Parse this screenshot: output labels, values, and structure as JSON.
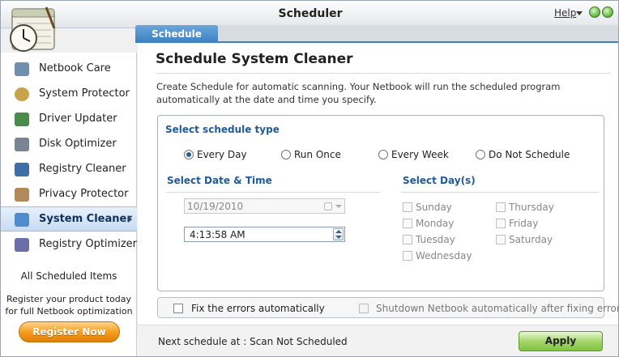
{
  "window": {
    "title": "Scheduler",
    "help_label": "Help"
  },
  "tabs": [
    {
      "label": "Schedule"
    }
  ],
  "sidebar": {
    "items": [
      {
        "label": "Netbook Care",
        "icon": "netbook-care-icon",
        "color": "#6f8fae"
      },
      {
        "label": "System Protector",
        "icon": "shield-icon",
        "color": "#c9a24a"
      },
      {
        "label": "Driver Updater",
        "icon": "driver-icon",
        "color": "#4a8b4a"
      },
      {
        "label": "Disk Optimizer",
        "icon": "disk-icon",
        "color": "#7a8594"
      },
      {
        "label": "Registry Cleaner",
        "icon": "registry-cleaner-icon",
        "color": "#3d6fa6"
      },
      {
        "label": "Privacy Protector",
        "icon": "privacy-icon",
        "color": "#b08a5a"
      },
      {
        "label": "System Cleaner",
        "icon": "broom-icon",
        "color": "#4f8ccc"
      },
      {
        "label": "Registry Optimizer",
        "icon": "registry-optimizer-icon",
        "color": "#6a6fa8"
      }
    ],
    "active_index": 6,
    "all_scheduled_label": "All Scheduled Items",
    "register_text_line1": "Register your product today",
    "register_text_line2": "for full Netbook optimization",
    "register_button": "Register Now"
  },
  "main": {
    "title": "Schedule System Cleaner",
    "description": "Create Schedule for automatic scanning. Your Netbook will run the scheduled program automatically at the date and time you specify.",
    "schedule_type_heading": "Select schedule type",
    "schedule_types": [
      "Every Day",
      "Run Once",
      "Every Week",
      "Do Not Schedule"
    ],
    "selected_schedule_type": "Every Day",
    "date_time_heading": "Select Date & Time",
    "date_value": "10/19/2010",
    "time_value": "4:13:58 AM",
    "days_heading": "Select Day(s)",
    "days": [
      "Sunday",
      "Monday",
      "Tuesday",
      "Wednesday",
      "Thursday",
      "Friday",
      "Saturday"
    ],
    "fix_errors_label": "Fix the errors automatically",
    "shutdown_label": "Shutdown Netbook automatically after fixing errors",
    "next_schedule_label": "Next schedule at : Scan Not Scheduled",
    "apply_label": "Apply"
  },
  "colors": {
    "accent": "#3c7fc1",
    "heading_blue": "#1f5a9c",
    "register_orange": "#f39a1c",
    "apply_green": "#a4d66b"
  }
}
